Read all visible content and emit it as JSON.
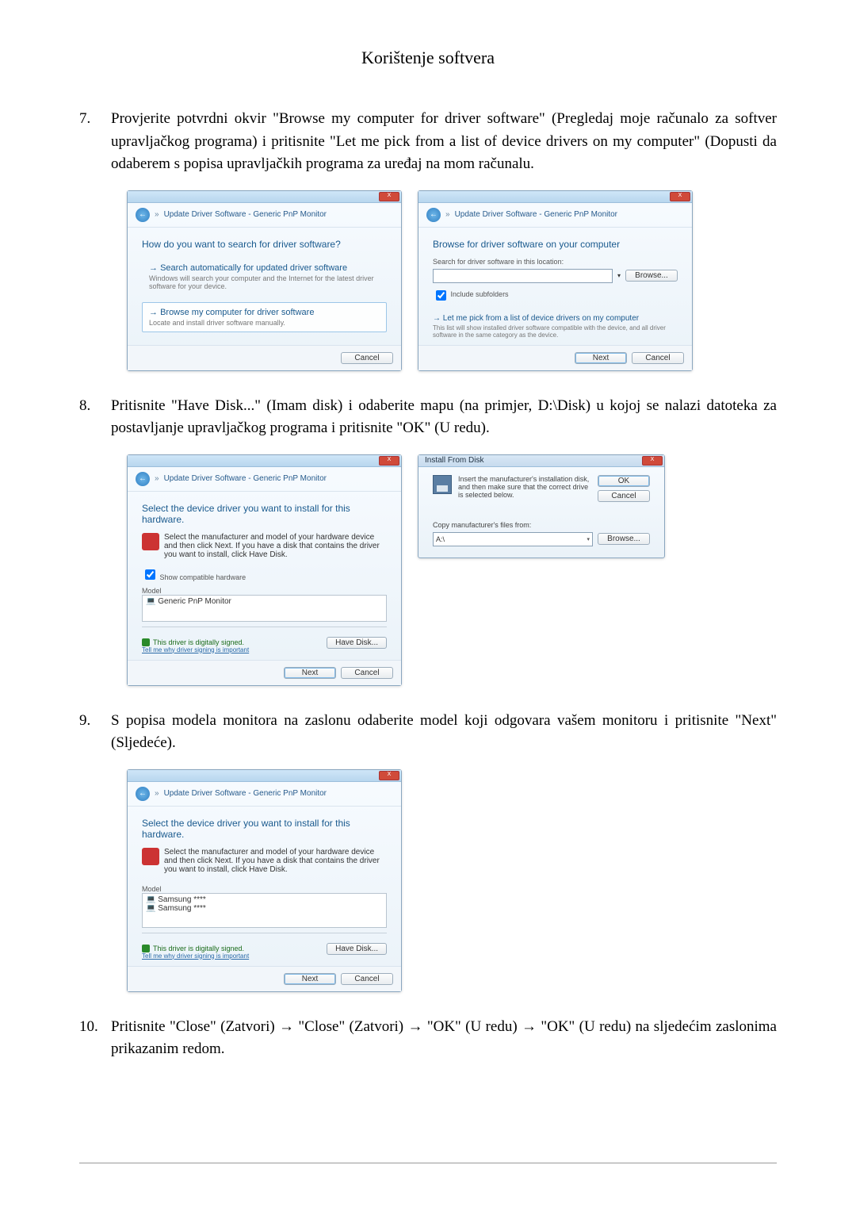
{
  "header": {
    "title": "Korištenje softvera"
  },
  "steps": {
    "s7": {
      "num": "7.",
      "text": "Provjerite potvrdni okvir \"Browse my computer for driver software\" (Pregledaj moje računalo za softver upravljačkog programa) i pritisnite \"Let me pick from a list of device drivers on my computer\" (Dopusti da odaberem s popisa upravljačkih programa za uređaj na mom računalu."
    },
    "s8": {
      "num": "8.",
      "text": "Pritisnite \"Have Disk...\" (Imam disk) i odaberite mapu (na primjer, D:\\Disk) u kojoj se nalazi datoteka za postavljanje upravljačkog programa i pritisnite \"OK\" (U redu)."
    },
    "s9": {
      "num": "9.",
      "text": "S popisa modela monitora na zaslonu odaberite model koji odgovara vašem monitoru i pritisnite \"Next\" (Sljedeće)."
    },
    "s10": {
      "num": "10.",
      "text": "Pritisnite \"Close\" (Zatvori) → \"Close\" (Zatvori) → \"OK\" (U redu) → \"OK\" (U redu) na sljedećim zaslonima prikazanim redom."
    }
  },
  "dlg7a": {
    "crumb": "Update Driver Software - Generic PnP Monitor",
    "title": "How do you want to search for driver software?",
    "opt1_t": "Search automatically for updated driver software",
    "opt1_d": "Windows will search your computer and the Internet for the latest driver software for your device.",
    "opt2_t": "Browse my computer for driver software",
    "opt2_d": "Locate and install driver software manually.",
    "cancel": "Cancel"
  },
  "dlg7b": {
    "crumb": "Update Driver Software - Generic PnP Monitor",
    "title": "Browse for driver software on your computer",
    "lbl": "Search for driver software in this location:",
    "browse": "Browse...",
    "chk": "Include subfolders",
    "hint_t": "Let me pick from a list of device drivers on my computer",
    "hint_d": "This list will show installed driver software compatible with the device, and all driver software in the same category as the device.",
    "next": "Next",
    "cancel": "Cancel"
  },
  "dlg8a": {
    "crumb": "Update Driver Software - Generic PnP Monitor",
    "title": "Select the device driver you want to install for this hardware.",
    "desc": "Select the manufacturer and model of your hardware device and then click Next. If you have a disk that contains the driver you want to install, click Have Disk.",
    "chk": "Show compatible hardware",
    "model_h": "Model",
    "model_v": "Generic PnP Monitor",
    "signed": "This driver is digitally signed.",
    "tell": "Tell me why driver signing is important",
    "havedisk": "Have Disk...",
    "next": "Next",
    "cancel": "Cancel"
  },
  "dlg8b": {
    "title": "Install From Disk",
    "msg": "Insert the manufacturer's installation disk, and then make sure that the correct drive is selected below.",
    "ok": "OK",
    "cancel": "Cancel",
    "copy": "Copy manufacturer's files from:",
    "path": "A:\\",
    "browse": "Browse..."
  },
  "dlg9": {
    "crumb": "Update Driver Software - Generic PnP Monitor",
    "title": "Select the device driver you want to install for this hardware.",
    "desc": "Select the manufacturer and model of your hardware device and then click Next. If you have a disk that contains the driver you want to install, click Have Disk.",
    "model_h": "Model",
    "m1": "Samsung ****",
    "m2": "Samsung ****",
    "signed": "This driver is digitally signed.",
    "tell": "Tell me why driver signing is important",
    "havedisk": "Have Disk...",
    "next": "Next",
    "cancel": "Cancel"
  }
}
